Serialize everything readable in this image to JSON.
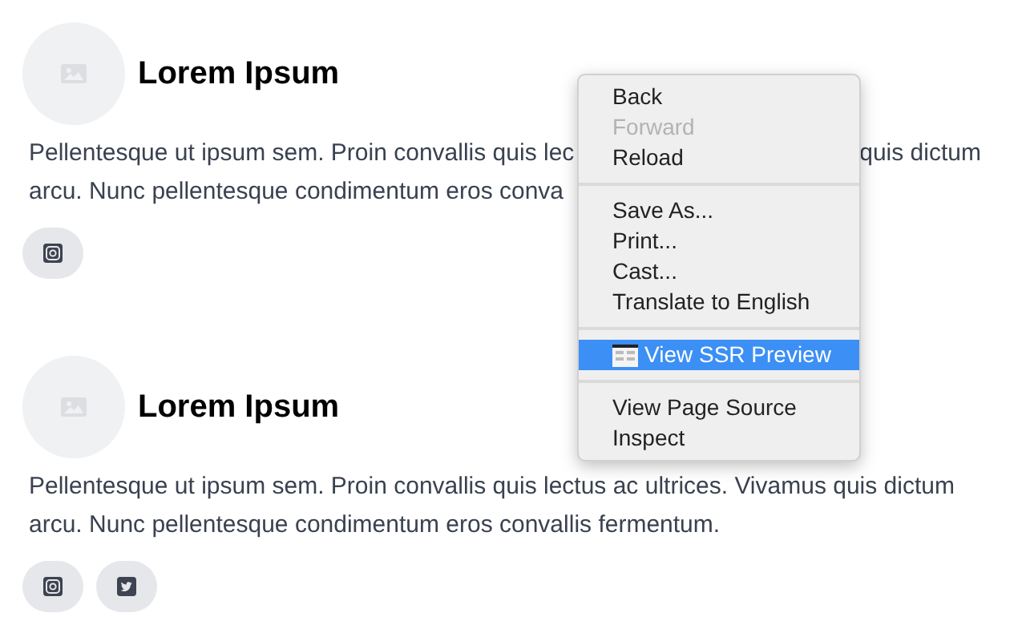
{
  "cards": [
    {
      "title": "Lorem Ipsum",
      "text_lines": [
        [
          "Pellentesque ut ipsum sem. Proin convallis quis lec",
          "quis dictum"
        ],
        [
          "arcu. Nunc pellentesque condimentum eros conva"
        ]
      ],
      "social_links": [
        {
          "kind": "instagram"
        }
      ]
    },
    {
      "title": "Lorem Ipsum",
      "text": "Pellentesque ut ipsum sem. Proin convallis quis lectus ac ultrices. Vivamus quis dictum arcu. Nunc pellentesque condimentum eros convallis fermentum.",
      "social_links": [
        {
          "kind": "instagram"
        },
        {
          "kind": "twitter"
        }
      ]
    }
  ],
  "context_menu": [
    {
      "kind": "item",
      "label": "Back",
      "disabled": false,
      "selected": false
    },
    {
      "kind": "item",
      "label": "Forward",
      "disabled": true,
      "selected": false
    },
    {
      "kind": "item",
      "label": "Reload",
      "disabled": false,
      "selected": false
    },
    {
      "kind": "separator"
    },
    {
      "kind": "item",
      "label": "Save As...",
      "disabled": false,
      "selected": false
    },
    {
      "kind": "item",
      "label": "Print...",
      "disabled": false,
      "selected": false
    },
    {
      "kind": "item",
      "label": "Cast...",
      "disabled": false,
      "selected": false
    },
    {
      "kind": "item",
      "label": "Translate to English",
      "disabled": false,
      "selected": false
    },
    {
      "kind": "separator"
    },
    {
      "kind": "item",
      "label": "View SSR Preview",
      "disabled": false,
      "selected": true,
      "icon": true
    },
    {
      "kind": "separator"
    },
    {
      "kind": "item",
      "label": "View Page Source",
      "disabled": false,
      "selected": false
    },
    {
      "kind": "item",
      "label": "Inspect",
      "disabled": false,
      "selected": false
    }
  ]
}
